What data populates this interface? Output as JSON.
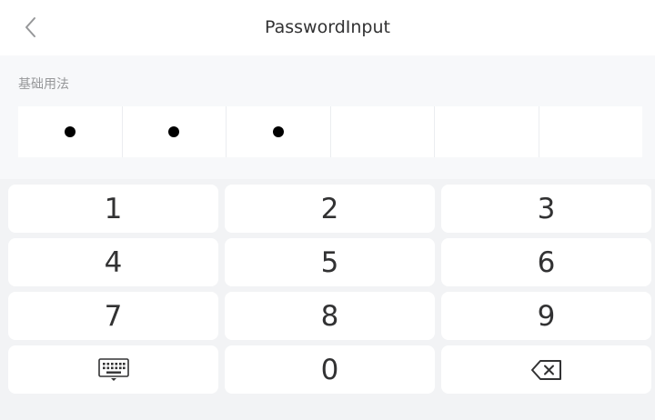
{
  "navbar": {
    "title": "PasswordInput",
    "back_icon": "chevron-left-icon"
  },
  "section": {
    "title": "基础用法"
  },
  "password": {
    "length": 6,
    "filled": 3
  },
  "keyboard": {
    "rows": [
      [
        "1",
        "2",
        "3"
      ],
      [
        "4",
        "5",
        "6"
      ],
      [
        "7",
        "8",
        "9"
      ],
      [
        "",
        "0",
        ""
      ]
    ],
    "collapse_icon": "keyboard-icon",
    "delete_icon": "backspace-icon"
  }
}
